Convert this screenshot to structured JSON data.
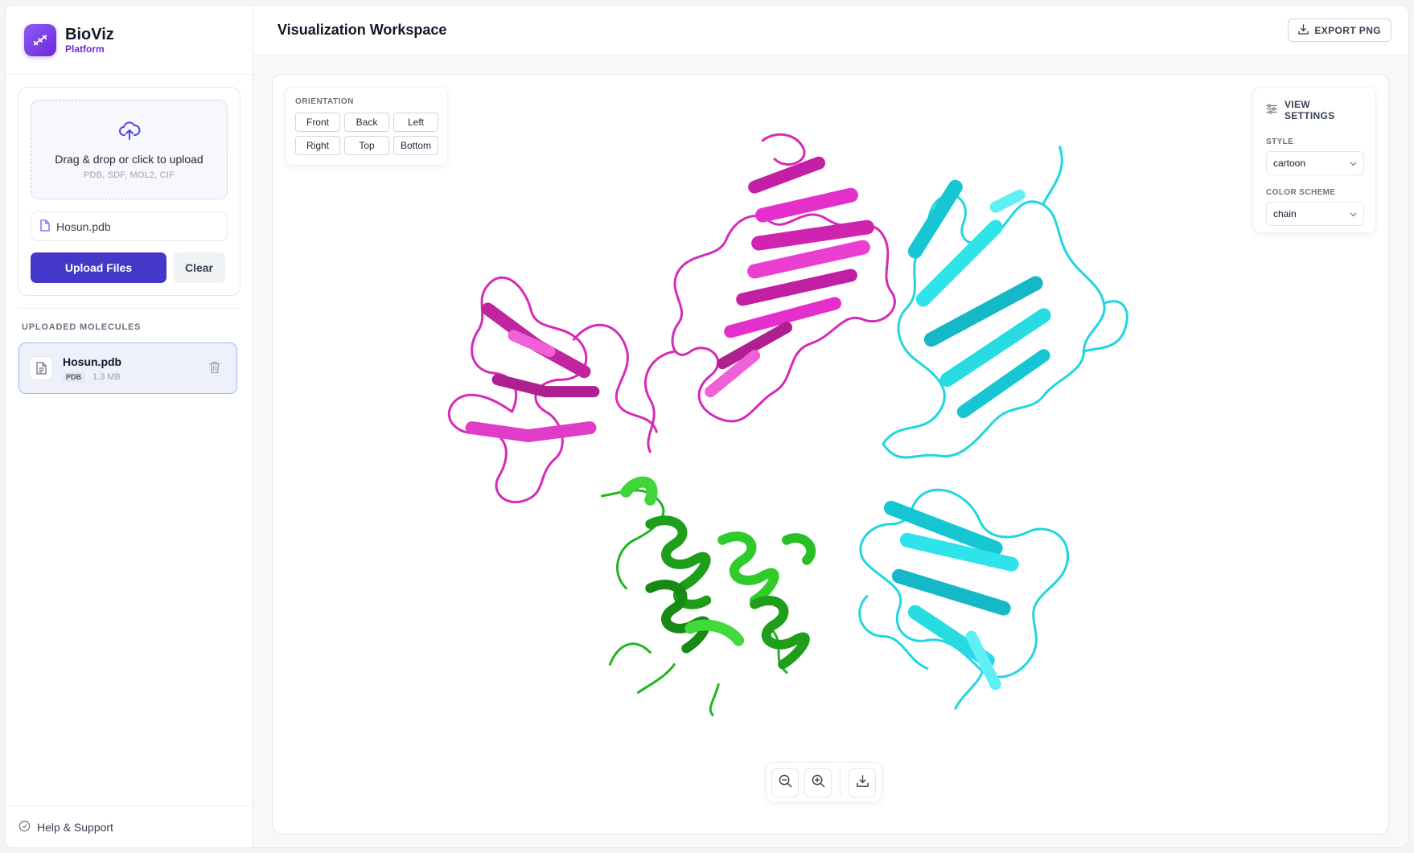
{
  "brand": {
    "name": "BioViz",
    "subtitle": "Platform"
  },
  "upload": {
    "dropzone_title": "Drag & drop or click to upload",
    "dropzone_formats": "PDB, SDF, MOL2, CIF",
    "selected_file": "Hosun.pdb",
    "upload_label": "Upload Files",
    "clear_label": "Clear"
  },
  "molecules": {
    "section_label": "UPLOADED MOLECULES",
    "items": [
      {
        "name": "Hosun.pdb",
        "type": "PDB",
        "size": "1.3 MB"
      }
    ]
  },
  "footer": {
    "help_label": "Help & Support"
  },
  "header": {
    "title": "Visualization Workspace",
    "export_label": "EXPORT PNG"
  },
  "orientation": {
    "label": "ORIENTATION",
    "buttons": [
      "Front",
      "Back",
      "Left",
      "Right",
      "Top",
      "Bottom"
    ]
  },
  "view_settings": {
    "title": "VIEW SETTINGS",
    "style_label": "STYLE",
    "style_value": "cartoon",
    "color_label": "COLOR SCHEME",
    "color_value": "chain"
  },
  "colors": {
    "accent": "#4338ca",
    "brand": "#6d28d9",
    "chain_a": "#d62ab8",
    "chain_b": "#1fd6e0",
    "chain_c": "#22b51f"
  },
  "icons": {
    "upload": "cloud-upload-icon",
    "file": "file-icon",
    "delete": "trash-icon",
    "help": "help-circle-icon",
    "export": "download-icon",
    "settings": "sliders-icon",
    "zoom_out": "zoom-out-icon",
    "zoom_in": "zoom-in-icon",
    "download": "download-icon"
  }
}
